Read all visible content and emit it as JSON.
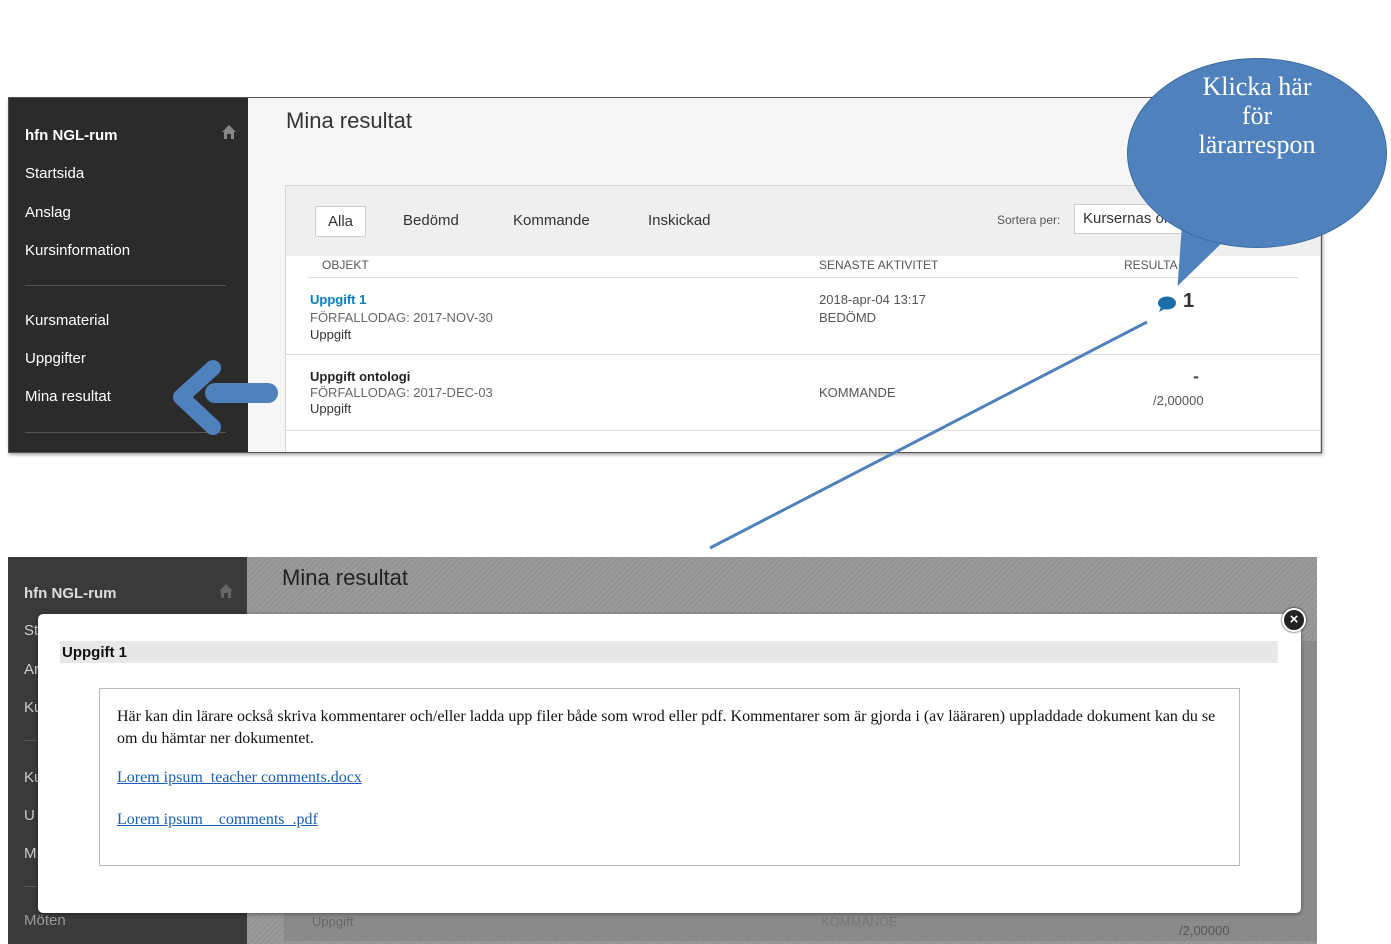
{
  "sidebar": {
    "title": "hfn NGL-rum",
    "items_top": [
      "Startsida",
      "Anslag",
      "Kursinformation"
    ],
    "items_bottom": [
      "Kursmaterial",
      "Uppgifter",
      "Mina resultat"
    ]
  },
  "page": {
    "title": "Mina resultat"
  },
  "filters": [
    "Alla",
    "Bedömd",
    "Kommande",
    "Inskickad"
  ],
  "sort": {
    "label": "Sortera per:",
    "value": "Kursernas ord"
  },
  "columns": [
    "OBJEKT",
    "SENASTE AKTIVITET",
    "RESULTA"
  ],
  "rows": [
    {
      "title": "Uppgift 1",
      "due": "FÖRFALLODAG: 2017-NOV-30",
      "type": "Uppgift",
      "activity_date": "2018-apr-04 13:17",
      "activity_status": "BEDÖMD",
      "result": "1"
    },
    {
      "title": "Uppgift ontologi",
      "due": "FÖRFALLODAG: 2017-DEC-03",
      "type": "Uppgift",
      "activity_status": "KOMMANDE",
      "result_dash": "-",
      "result_max": "/2,00000"
    }
  ],
  "callout": {
    "text_line1": "Klicka här",
    "text_line2": "för",
    "text_line3": "lärarrespon",
    "color": "#4f81bd"
  },
  "bottom": {
    "sidebar_title": "hfn NGL-rum",
    "sidebar_partial": [
      "St",
      "Ar",
      "Ku",
      "Ku",
      "U",
      "M"
    ],
    "sidebar_moten": "Möten",
    "page_title": "Mina resultat",
    "row_type": "Uppgift",
    "row_status": "KOMMANDE",
    "row_result": "/2,00000"
  },
  "modal": {
    "title": "Uppgift 1",
    "text": "Här kan din lärare också skriva kommentarer och/eller ladda upp filer både som wrod eller pdf. Kommentarer som är gjorda i (av lääraren) uppladdade dokument kan du se om du hämtar ner dokumentet.",
    "links": [
      "Lorem ipsum_teacher comments.docx",
      "Lorem ipsum__comments_.pdf"
    ],
    "close_icon": "×"
  }
}
